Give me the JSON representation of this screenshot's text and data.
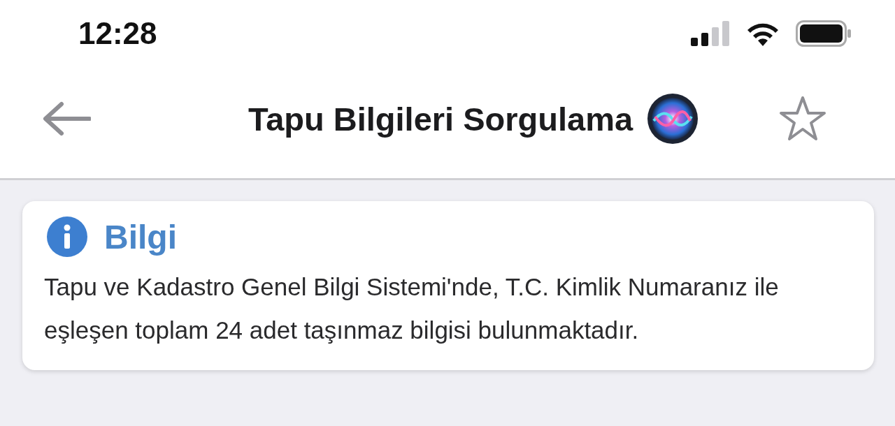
{
  "status_bar": {
    "time": "12:28"
  },
  "nav_bar": {
    "title": "Tapu Bilgileri Sorgulama"
  },
  "info_card": {
    "title": "Bilgi",
    "message": "Tapu ve Kadastro Genel Bilgi Sistemi'nde, T.C. Kimlik Numaranız ile eşleşen toplam 24 adet taşınmaz bilgisi bulunmaktadır."
  }
}
